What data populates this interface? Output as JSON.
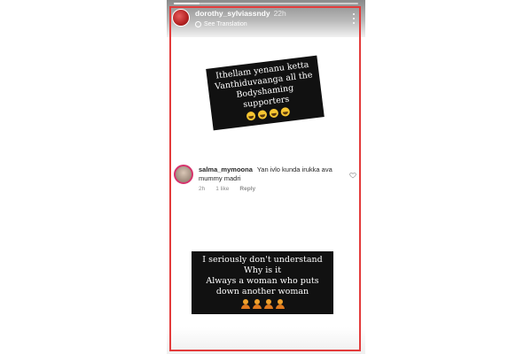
{
  "story": {
    "progress": 0.14,
    "header": {
      "username": "dorothy_sylviassndy",
      "time": "22h",
      "translation_label": "See Translation"
    },
    "sticker_top": {
      "lines": [
        "Ithellam yenanu ketta",
        "Vanthiduvaanga all the",
        "Bodyshaming supporters"
      ],
      "emoji": [
        "laughing-face",
        "laughing-face",
        "laughing-face",
        "laughing-face"
      ]
    },
    "comment": {
      "username": "salma_mymoona",
      "text": "Yan ivlo kunda irukka ava mummy madri",
      "time": "2h",
      "likes": "1 like",
      "reply_label": "Reply"
    },
    "sticker_bottom": {
      "lines": [
        "I seriously don't understand",
        "Why is it",
        "Always a woman who puts",
        "down another woman"
      ],
      "emoji": [
        "person-icon",
        "person-icon",
        "person-icon",
        "person-icon"
      ]
    }
  },
  "colors": {
    "highlight_border": "#e33b3b",
    "sticker_bg": "#111111",
    "sticker_text": "#ffffff"
  }
}
